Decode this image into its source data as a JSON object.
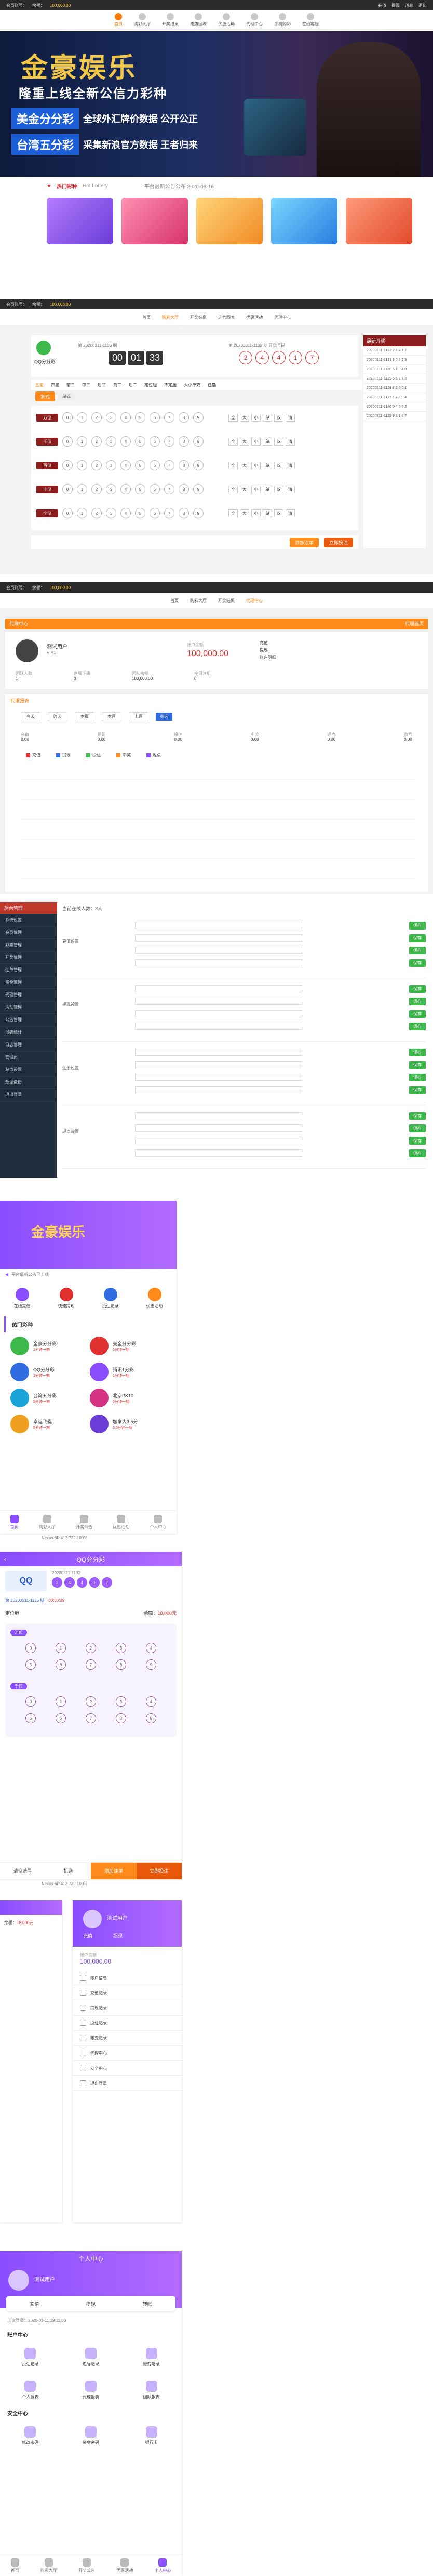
{
  "brand": {
    "accent": "#ff7a00",
    "purple": "#8a4dff",
    "dark": "#2a2a2a",
    "green": "#3db84a",
    "blue": "#2f6de0",
    "red": "#e03030"
  },
  "top_nav": {
    "user_label": "会员账号：",
    "balance_label": "余额：",
    "balance_value": "100,000.00",
    "links": [
      "充值",
      "提现",
      "消息",
      "退出"
    ],
    "items": [
      "首页",
      "购彩大厅",
      "开奖结果",
      "走势图表",
      "优惠活动",
      "代理中心",
      "手机购彩",
      "在线客服"
    ]
  },
  "banner": {
    "logo_text": "金豪娱乐",
    "slogan": "隆重上线全新公信力彩种",
    "line1_tag": "美金分分彩",
    "line1_text": "全球外汇牌价数据 公开公正",
    "line2_tag": "台湾五分彩",
    "line2_text": "采集新浪官方数据 王者归来"
  },
  "hot_games": {
    "title": "热门彩种",
    "subtitle": "Hot Lottery",
    "notice": "平台最新公告公布 2020-03-16"
  },
  "lottery_page": {
    "game_name": "QQ分分彩",
    "issue_label": "第 20200311-1133 期",
    "countdown": [
      "00",
      "01",
      "33"
    ],
    "countdown_label": "距离投注截止还有",
    "last_issue_label": "第 20200311-1132 期 开奖号码",
    "result_balls": [
      "2",
      "4",
      "4",
      "1",
      "7"
    ],
    "tabs": [
      "五星",
      "四星",
      "前三",
      "中三",
      "后三",
      "前二",
      "后二",
      "定位胆",
      "不定胆",
      "大小单双",
      "任选"
    ],
    "sub_tabs": [
      "复式",
      "单式"
    ],
    "rows": [
      {
        "label": "万位"
      },
      {
        "label": "千位"
      },
      {
        "label": "百位"
      },
      {
        "label": "十位"
      },
      {
        "label": "个位"
      }
    ],
    "digits": [
      "0",
      "1",
      "2",
      "3",
      "4",
      "5",
      "6",
      "7",
      "8",
      "9"
    ],
    "filters": [
      "全",
      "大",
      "小",
      "单",
      "双",
      "清"
    ],
    "bet_button": "立即投注",
    "add_button": "添加注单",
    "side_title": "最新开奖",
    "side_rows": [
      "20200311-1132  2 4 4 1 7",
      "20200311-1131  3 0 8 2 5",
      "20200311-1130  6 1 9 4 0",
      "20200311-1129  5 5 2 7 3",
      "20200311-1128  8 2 6 0 1",
      "20200311-1127  1 7 3 9 4",
      "20200311-1126  0 4 5 6 2",
      "20200311-1125  9 3 1 8 7"
    ]
  },
  "agent_page": {
    "header": "代理中心",
    "header_btn": "代理首页",
    "user_name": "测试用户",
    "user_level": "VIP1",
    "balance_label": "账户余额",
    "balance_value": "100,000.00",
    "side_links": [
      "充值",
      "提现",
      "账户明细"
    ],
    "stats": [
      {
        "label": "团队人数",
        "value": "1"
      },
      {
        "label": "直属下级",
        "value": "0"
      },
      {
        "label": "团队余额",
        "value": "100,000.00"
      },
      {
        "label": "今日注册",
        "value": "0"
      }
    ],
    "section_title": "代理报表",
    "filters": [
      "今天",
      "昨天",
      "本周",
      "本月",
      "上月"
    ],
    "search_btn": "查询",
    "metrics": [
      {
        "label": "充值",
        "value": "0.00"
      },
      {
        "label": "提现",
        "value": "0.00"
      },
      {
        "label": "投注",
        "value": "0.00"
      },
      {
        "label": "中奖",
        "value": "0.00"
      },
      {
        "label": "返点",
        "value": "0.00"
      },
      {
        "label": "盈亏",
        "value": "0.00"
      }
    ],
    "legend": [
      "充值",
      "提现",
      "投注",
      "中奖",
      "返点"
    ]
  },
  "admin_page": {
    "logo": "后台管理",
    "online_label": "当前在线人数：",
    "online_value": "3人",
    "menu": [
      "系统设置",
      "会员管理",
      "彩票管理",
      "开奖管理",
      "注单管理",
      "资金管理",
      "代理管理",
      "活动管理",
      "公告管理",
      "报表统计",
      "日志管理",
      "管理员",
      "站点设置",
      "数据备份",
      "退出登录"
    ],
    "group_labels": [
      "充值设置",
      "提现设置",
      "注册设置",
      "返点设置"
    ],
    "save_label": "保存"
  },
  "mobile_home": {
    "banner_text": "金豪娱乐",
    "notice": "平台最新公告已上线",
    "quick": [
      "在线充值",
      "快速提现",
      "投注记录",
      "优惠活动"
    ],
    "section": "热门彩种",
    "games": [
      {
        "name": "金豪分分彩",
        "desc": "1分钟一期"
      },
      {
        "name": "美金分分彩",
        "desc": "1分钟一期"
      },
      {
        "name": "QQ分分彩",
        "desc": "1分钟一期"
      },
      {
        "name": "腾讯1分彩",
        "desc": "1分钟一期"
      },
      {
        "name": "台湾五分彩",
        "desc": "5分钟一期"
      },
      {
        "name": "北京PK10",
        "desc": "5分钟一期"
      },
      {
        "name": "幸运飞艇",
        "desc": "5分钟一期"
      },
      {
        "name": "加拿大3.5分",
        "desc": "3.5分钟一期"
      }
    ],
    "tabs": [
      "首页",
      "购彩大厅",
      "开奖公告",
      "优惠活动",
      "个人中心"
    ],
    "status_bar": "Nexus 6P  412  732  100%"
  },
  "mobile_lottery": {
    "title": "QQ分分彩",
    "issue_label": "第 20200311-1133 期",
    "countdown": "00:00:39",
    "last_issue": "20200311-1132",
    "balls": [
      "2",
      "4",
      "4",
      "1",
      "7"
    ],
    "play_label": "定位胆",
    "balance_label": "余额：",
    "balance_value": "18,000元",
    "rows": [
      "万位",
      "千位"
    ],
    "digits": [
      "0",
      "1",
      "2",
      "3",
      "4",
      "5",
      "6",
      "7",
      "8",
      "9"
    ],
    "footer_amount_label": "注数",
    "footer_btns": [
      "清空选号",
      "机选",
      "添加注单",
      "立即投注"
    ]
  },
  "mobile_user": {
    "user_name": "测试用户",
    "balance_label": "账户余额",
    "balance_value": "100,000.00",
    "actions": [
      "充值",
      "提现"
    ],
    "menu": [
      "账户信息",
      "充值记录",
      "提现记录",
      "投注记录",
      "账变记录",
      "代理中心",
      "安全中心",
      "退出登录"
    ],
    "left_label": "余额：",
    "left_value": "18,000元"
  },
  "mobile_center": {
    "title": "个人中心",
    "user_name": "测试用户",
    "last_login": "上次登录：2020-03-11 19:11:00",
    "top_actions": [
      "充值",
      "提现",
      "转账"
    ],
    "sec1": "账户中心",
    "grid1": [
      "投注记录",
      "追号记录",
      "账变记录",
      "个人报表",
      "代理报表",
      "团队报表"
    ],
    "sec2": "安全中心",
    "grid2": [
      "修改密码",
      "资金密码",
      "银行卡"
    ],
    "tabs": [
      "首页",
      "购彩大厅",
      "开奖公告",
      "优惠活动",
      "个人中心"
    ]
  }
}
